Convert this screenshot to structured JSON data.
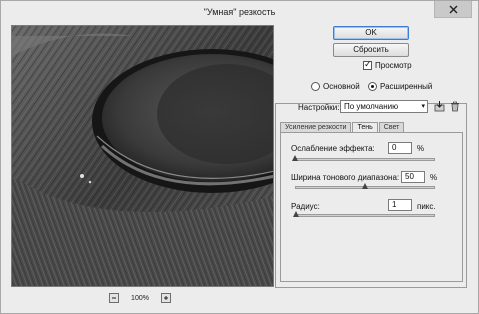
{
  "window": {
    "title": "\"Умная\" резкость"
  },
  "preview": {
    "zoom_value": "100%"
  },
  "buttons": {
    "ok": "OK",
    "reset": "Сбросить"
  },
  "preview_checkbox": {
    "label": "Просмотр",
    "checked": true
  },
  "mode": {
    "options": [
      {
        "label": "Основной",
        "selected": false
      },
      {
        "label": "Расширенный",
        "selected": true
      }
    ]
  },
  "settings": {
    "label": "Настройки:",
    "value": "По умолчанию"
  },
  "tabs": [
    {
      "label": "Усиление резкости",
      "active": false
    },
    {
      "label": "Тень",
      "active": true
    },
    {
      "label": "Свет",
      "active": false
    }
  ],
  "controls": {
    "fade": {
      "label": "Ослабление эффекта:",
      "value": "0",
      "unit": "%",
      "level": 0
    },
    "tonal_width": {
      "label": "Ширина тонового диапазона:",
      "value": "50",
      "unit": "%",
      "level": 0.5
    },
    "radius": {
      "label": "Радиус:",
      "value": "1",
      "unit": "пикс.",
      "level": 0.01
    }
  },
  "icons": {
    "close": "close-icon",
    "zoom_out": "minus-icon",
    "zoom_in": "plus-icon",
    "save": "save-preset-icon",
    "delete": "trash-icon"
  }
}
